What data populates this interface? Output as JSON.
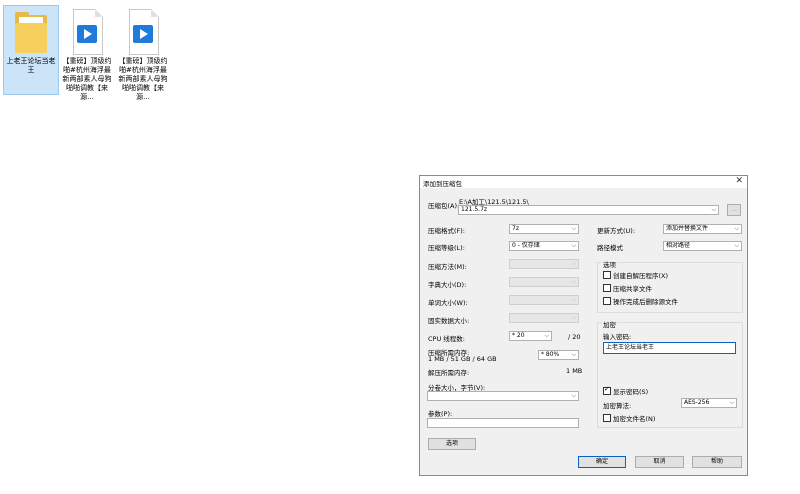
{
  "desktop": {
    "icons": [
      {
        "label": "上老王论坛当老王",
        "type": "folder"
      },
      {
        "label": "【重磅】顶级约啪#杭州海浮最新两部素人母狗啪啪调教【来源...",
        "type": "video"
      },
      {
        "label": "【重磅】顶级约啪#杭州海浮最新两部素人母狗啪啪调教【来源...",
        "type": "video"
      }
    ]
  },
  "dialog": {
    "title": "添加到压缩包",
    "close_glyph": "✕",
    "archive_label": "压缩包(A):",
    "archive_path": "E:\\A加工\\121.5\\121.5\\",
    "archive_name": "121.5.7z",
    "browse_label": "...",
    "format_label": "压缩格式(F):",
    "format_value": "7z",
    "level_label": "压缩等级(L):",
    "level_value": "0 - 仅存储",
    "method_label": "压缩方法(M):",
    "dict_label": "字典大小(D):",
    "word_label": "单词大小(W):",
    "solid_label": "固实数据大小:",
    "cpu_label": "CPU 线程数:",
    "cpu_value": "* 20",
    "cpu_max": "/ 20",
    "mem_comp_label": "压缩所需内存:",
    "mem_comp_detail": "1 MB / 51 GB / 64 GB",
    "mem_comp_value": "* 80%",
    "mem_decomp_label": "解压所需内存:",
    "mem_decomp_value": "1 MB",
    "split_label": "分卷大小，字节(V):",
    "params_label": "参数(P):",
    "options_button": "选项",
    "update_label": "更新方式(U):",
    "update_value": "添加并替换文件",
    "path_label": "路径模式",
    "path_value": "相对路径",
    "options_group": "选项",
    "opt_sfx": "创建自解压程序(X)",
    "opt_shared": "压缩共享文件",
    "opt_delete": "操作完成后删除源文件",
    "encrypt_group": "加密",
    "password_label": "输入密码:",
    "password_value": "上老王论坛当老王",
    "show_password": "显示密码(S)",
    "enc_method_label": "加密算法:",
    "enc_method_value": "AES-256",
    "enc_names": "加密文件名(N)",
    "ok_button": "确定",
    "cancel_button": "取消",
    "help_button": "帮助"
  }
}
